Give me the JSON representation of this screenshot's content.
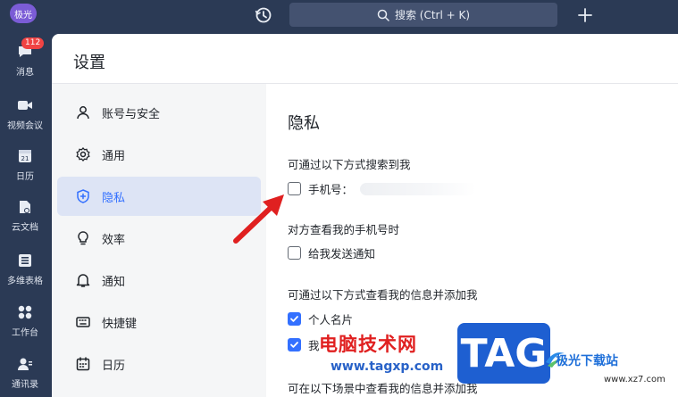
{
  "rail": {
    "avatar_label": "极光",
    "badge_count": "112",
    "items": [
      {
        "label": "消息",
        "icon": "chat-bubble-icon"
      },
      {
        "label": "视频会议",
        "icon": "video-camera-icon"
      },
      {
        "label": "日历",
        "icon": "calendar-icon"
      },
      {
        "label": "云文档",
        "icon": "cloud-doc-icon"
      },
      {
        "label": "多维表格",
        "icon": "table-icon"
      },
      {
        "label": "工作台",
        "icon": "grid-apps-icon"
      },
      {
        "label": "通讯录",
        "icon": "contacts-icon"
      }
    ]
  },
  "topbar": {
    "search_placeholder": "搜索 (Ctrl + K)"
  },
  "settings": {
    "title": "设置",
    "nav": [
      {
        "label": "账号与安全",
        "icon": "person-icon"
      },
      {
        "label": "通用",
        "icon": "gear-icon"
      },
      {
        "label": "隐私",
        "icon": "shield-plus-icon",
        "active": true
      },
      {
        "label": "效率",
        "icon": "lightbulb-icon"
      },
      {
        "label": "通知",
        "icon": "bell-icon"
      },
      {
        "label": "快捷键",
        "icon": "keyboard-icon"
      },
      {
        "label": "日历",
        "icon": "calendar-icon"
      }
    ],
    "privacy": {
      "title": "隐私",
      "search_group_label": "可通过以下方式搜索到我",
      "phone_option": {
        "label": "手机号：",
        "checked": false
      },
      "view_phone_label": "对方查看我的手机号时",
      "notify_option": {
        "label": "给我发送通知",
        "checked": false
      },
      "add_group_label": "可通过以下方式查看我的信息并添加我",
      "card_option": {
        "label": "个人名片",
        "checked": true
      },
      "second_option": {
        "label": "我",
        "checked": true
      },
      "scene_group_label": "可在以下场景中查看我的信息并添加我"
    }
  },
  "watermark": {
    "site_name": "电脑技术网",
    "site_url": "www.tagxp.com",
    "tag": "TAG",
    "logo_text": "极光下载站",
    "logo_url": "www.xz7.com"
  },
  "colors": {
    "rail_bg": "#2b3a55",
    "accent": "#3370ff",
    "active_nav_bg": "#dde4f5",
    "arrow": "#e02020"
  }
}
